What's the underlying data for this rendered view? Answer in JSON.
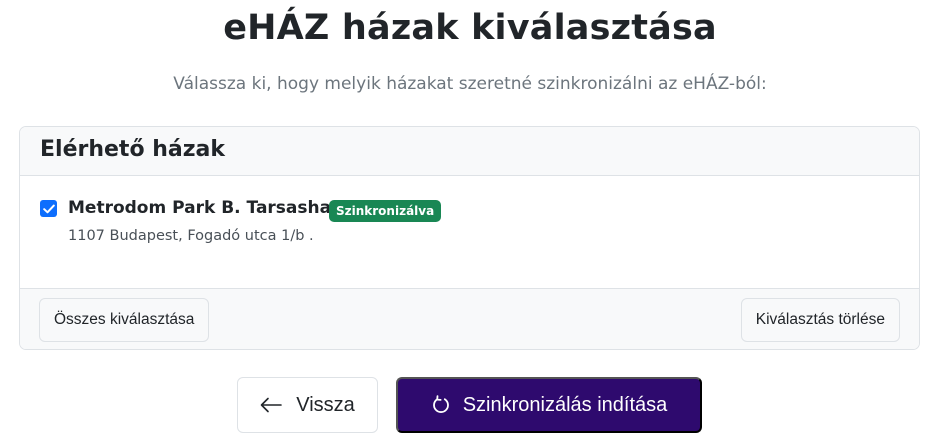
{
  "header": {
    "title": "eHÁZ házak kiválasztása",
    "subtitle": "Válassza ki, hogy melyik házakat szeretné szinkronizálni az eHÁZ-ból:"
  },
  "houses_card": {
    "heading": "Elérhető házak",
    "items": [
      {
        "name": "Metrodom Park B. Tarsashaz",
        "checked": true,
        "badge": "Szinkronizálva",
        "address": "1107 Budapest, Fogadó utca 1/b ."
      }
    ],
    "select_all_label": "Összes kiválasztása",
    "clear_selection_label": "Kiválasztás törlése"
  },
  "actions": {
    "back_label": "Vissza",
    "back_icon": "arrow-left-icon",
    "sync_label": "Szinkronizálás indítása",
    "sync_icon": "refresh-icon"
  },
  "colors": {
    "primary_button": "#2e0a6e",
    "badge_success": "#198754",
    "checkbox": "#0d6efd"
  }
}
